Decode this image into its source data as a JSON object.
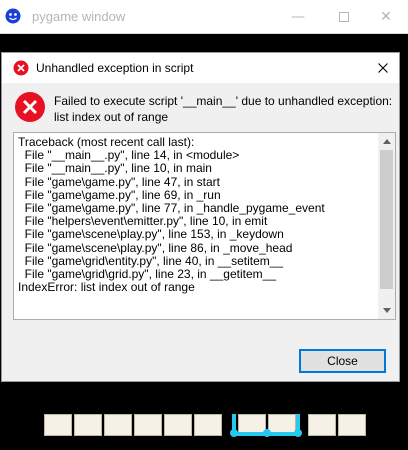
{
  "window": {
    "title": "pygame window",
    "minimize_icon": "minimize-icon",
    "maximize_icon": "maximize-icon",
    "close_icon": "close-icon"
  },
  "dialog": {
    "title": "Unhandled exception in script",
    "message": "Failed to execute script '__main__' due to unhandled exception: list index out of range",
    "traceback": [
      "Traceback (most recent call last):",
      "  File \"__main__.py\", line 14, in <module>",
      "  File \"__main__.py\", line 10, in main",
      "  File \"game\\game.py\", line 47, in start",
      "  File \"game\\game.py\", line 69, in _run",
      "  File \"game\\game.py\", line 77, in _handle_pygame_event",
      "  File \"helpers\\event\\emitter.py\", line 10, in emit",
      "  File \"game\\scene\\play.py\", line 153, in _keydown",
      "  File \"game\\scene\\play.py\", line 86, in _move_head",
      "  File \"game\\grid\\entity.py\", line 40, in __setitem__",
      "  File \"game\\grid\\grid.py\", line 23, in __getitem__",
      "IndexError: list index out of range"
    ],
    "close_label": "Close",
    "error_icon": "error-icon"
  },
  "colors": {
    "accent": "#0078d7",
    "error_red": "#e81123",
    "snake_cyan": "#27c8f0"
  }
}
